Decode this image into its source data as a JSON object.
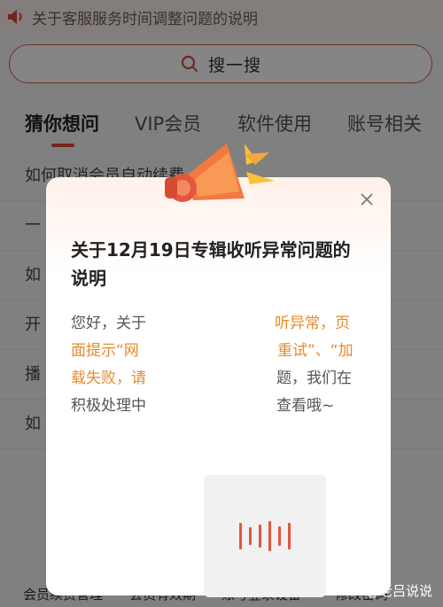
{
  "notice": {
    "text": "关于客服服务时间调整问题的说明"
  },
  "search": {
    "label": "搜一搜"
  },
  "tabs": [
    {
      "label": "猜你想问"
    },
    {
      "label": "VIP会员"
    },
    {
      "label": "软件使用"
    },
    {
      "label": "账号相关"
    }
  ],
  "questions": [
    {
      "label": "如何取消会员自动续费"
    },
    {
      "label": "一"
    },
    {
      "label": "如"
    },
    {
      "label": "开"
    },
    {
      "label": "播"
    },
    {
      "label": "如"
    }
  ],
  "bottom_links": [
    {
      "label": "会员续费管理"
    },
    {
      "label": "会员有效期"
    },
    {
      "label": "账号登录设备"
    },
    {
      "label": "修改密码"
    }
  ],
  "modal": {
    "title": "关于12月19日专辑收听异常问题的说明",
    "body": {
      "p1": "您好，关于",
      "p2": "听异常，页",
      "p3": "面提示“网",
      "p4": "重试”、“加",
      "p5": "载失败，请",
      "p6": "题，我们在",
      "p7": "积极处理中",
      "p8": "查看哦~"
    }
  },
  "watermark": "@老吕说说",
  "colors": {
    "accent": "#e0453b",
    "highlight": "#e88a2c"
  }
}
